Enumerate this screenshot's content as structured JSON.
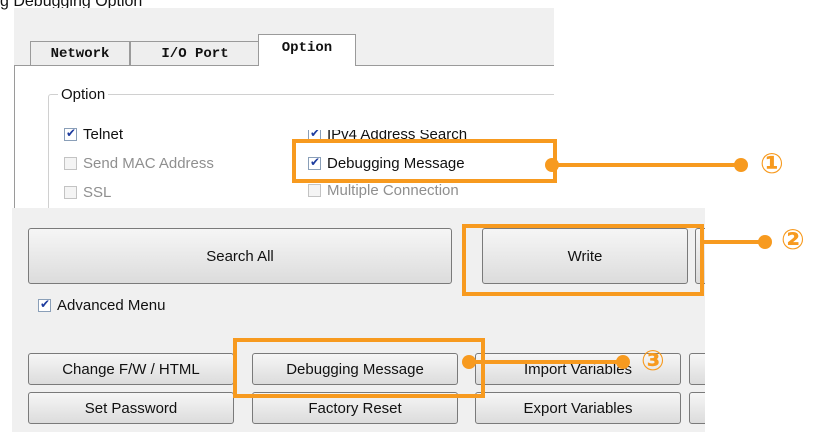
{
  "top": {
    "caption": "g Debugging Option",
    "tabs": [
      "Network",
      "I/O Port",
      "Option"
    ],
    "group_title": "Option",
    "checkboxes": {
      "telnet": "Telnet",
      "send_mac": "Send MAC Address",
      "ssl": "SSL",
      "ipv4_search": "IPv4 Address Search",
      "debug_msg": "Debugging Message",
      "multi_conn": "Multiple Connection"
    }
  },
  "bottom": {
    "search_all": "Search All",
    "write": "Write",
    "advanced_menu": "Advanced Menu",
    "change_fw": "Change F/W / HTML",
    "debugging_message": "Debugging Message",
    "import_variables": "Import Variables",
    "set_password": "Set Password",
    "factory_reset": "Factory Reset",
    "export_variables": "Export Variables"
  },
  "callouts": [
    "①",
    "②",
    "③"
  ],
  "colors": {
    "accent": "#f79a1f",
    "check": "#1e3c9e"
  }
}
